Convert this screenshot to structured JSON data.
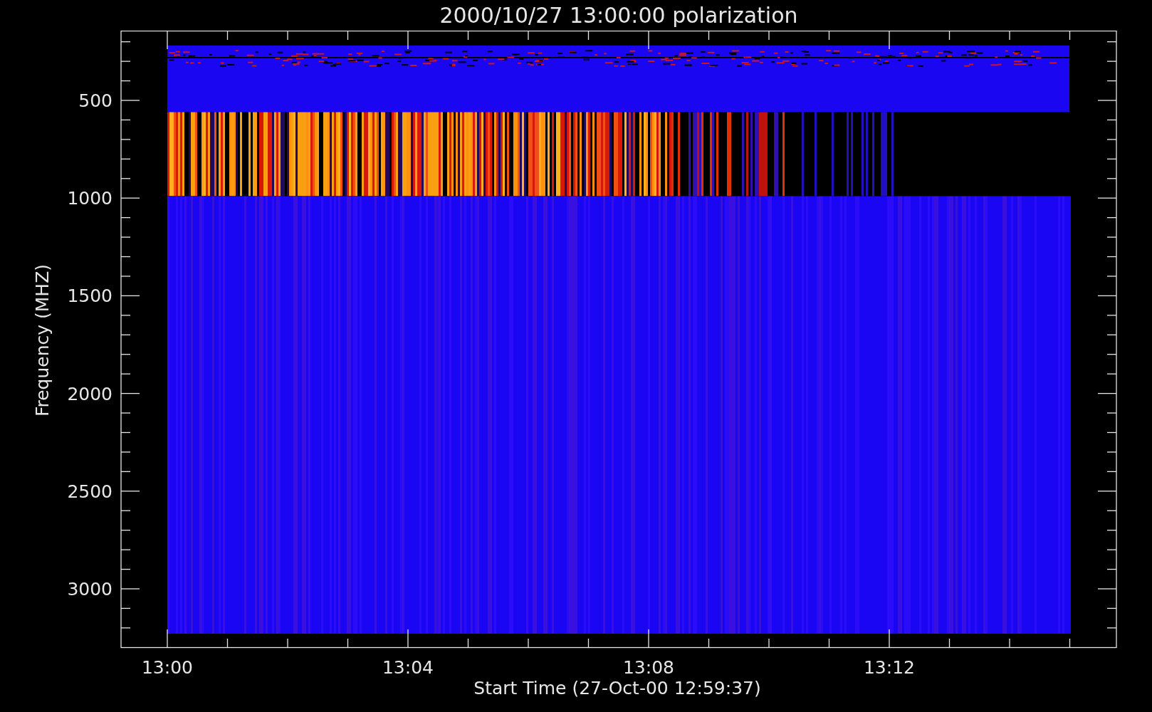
{
  "plot": {
    "title": "2000/10/27 13:00:00 polarization",
    "ylabel": "Frequency (MHZ)",
    "xlabel": "Start Time (27-Oct-00 12:59:37)",
    "yticks": [
      "500",
      "1000",
      "1500",
      "2000",
      "2500",
      "3000"
    ],
    "xticks": [
      "13:00",
      "13:04",
      "13:08",
      "13:12"
    ]
  }
}
